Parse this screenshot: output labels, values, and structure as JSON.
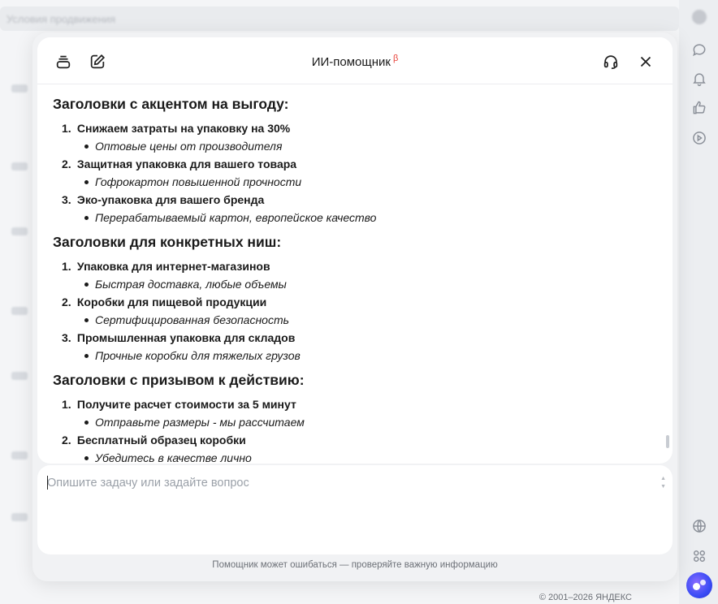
{
  "background": {
    "search_placeholder": "Условия продвижения",
    "footer": "© 2001–2026 ЯНДЕКС"
  },
  "rail": {
    "icons": [
      "chat-icon",
      "bell-icon",
      "thumbs-up-icon",
      "play-icon",
      "globe-icon",
      "apps-icon",
      "alice-icon"
    ]
  },
  "assistant": {
    "title": "ИИ-помощник",
    "beta": "β",
    "sections": [
      {
        "heading": "Заголовки с акцентом на выгоду:",
        "items": [
          {
            "num": "1.",
            "title": "Снижаем затраты на упаковку на 30%",
            "sub": "Оптовые цены от производителя"
          },
          {
            "num": "2.",
            "title": "Защитная упаковка для вашего товара",
            "sub": "Гофрокартон повышенной прочности"
          },
          {
            "num": "3.",
            "title": "Эко-упаковка для вашего бренда",
            "sub": "Перерабатываемый картон, европейское качество"
          }
        ]
      },
      {
        "heading": "Заголовки для конкретных ниш:",
        "items": [
          {
            "num": "1.",
            "title": "Упаковка для интернет-магазинов",
            "sub": "Быстрая доставка, любые объемы"
          },
          {
            "num": "2.",
            "title": "Коробки для пищевой продукции",
            "sub": "Сертифицированная безопасность"
          },
          {
            "num": "3.",
            "title": "Промышленная упаковка для складов",
            "sub": "Прочные коробки для тяжелых грузов"
          }
        ]
      },
      {
        "heading": "Заголовки с призывом к действию:",
        "items": [
          {
            "num": "1.",
            "title": "Получите расчет стоимости за 5 минут",
            "sub": "Отправьте размеры - мы рассчитаем"
          },
          {
            "num": "2.",
            "title": "Бесплатный образец коробки",
            "sub": "Убедитесь в качестве лично"
          }
        ]
      }
    ],
    "input_placeholder": "Опишите задачу или задайте вопрос",
    "disclaimer": "Помощник может ошибаться — проверяйте важную информацию"
  }
}
